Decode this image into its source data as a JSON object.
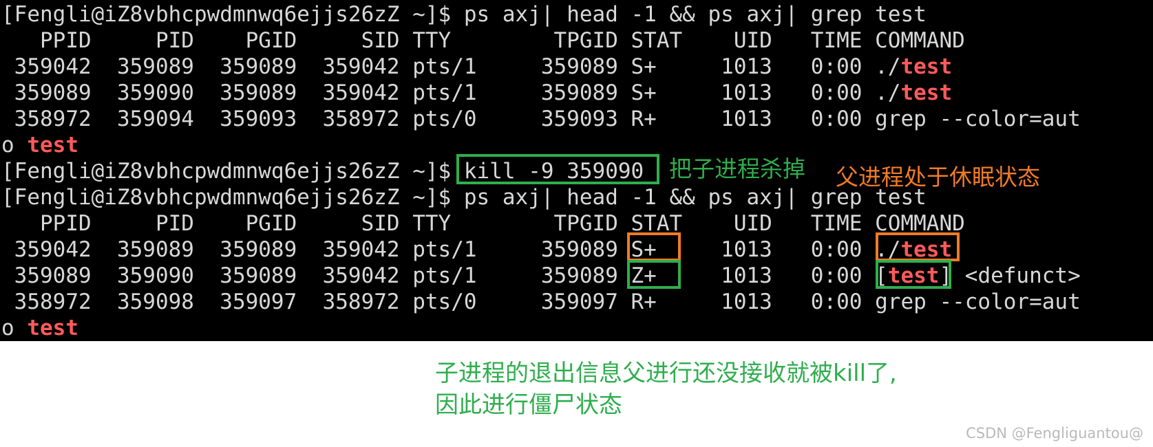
{
  "terminal": {
    "background_color": "#000000",
    "foreground_color": "#d8d8d8",
    "highlight_color": "#ff5a5a",
    "prompt": "[Fengli@iZ8vbhcpwdmnwq6ejjs26zZ ~]$ ",
    "lines": [
      {
        "id": "line-1-command",
        "kind": "prompt-command",
        "prompt": "[Fengli@iZ8vbhcpwdmnwq6ejjs26zZ ~]$ ",
        "command": "ps axj| head -1 && ps axj| grep test"
      },
      {
        "id": "line-2-header",
        "kind": "header",
        "text": "   PPID     PID    PGID     SID TTY        TPGID STAT    UID   TIME COMMAND"
      },
      {
        "id": "line-3-row",
        "kind": "row",
        "pre": " 359042  359089  359089  359042 pts/1     359089 S+     1013   0:00 ./",
        "match": "test",
        "post": ""
      },
      {
        "id": "line-4-row",
        "kind": "row",
        "pre": " 359089  359090  359089  359042 pts/1     359089 S+     1013   0:00 ./",
        "match": "test",
        "post": ""
      },
      {
        "id": "line-5-row",
        "kind": "row",
        "pre": " 358972  359094  359093  358972 pts/0     359093 R+     1013   0:00 grep --color=aut",
        "match": "",
        "post": ""
      },
      {
        "id": "line-6-wrap",
        "kind": "row",
        "pre": "o ",
        "match": "test",
        "post": ""
      },
      {
        "id": "line-7-command",
        "kind": "prompt-command",
        "prompt": "[Fengli@iZ8vbhcpwdmnwq6ejjs26zZ ~]$ ",
        "command": "kill -9 359090"
      },
      {
        "id": "line-8-command",
        "kind": "prompt-command",
        "prompt": "[Fengli@iZ8vbhcpwdmnwq6ejjs26zZ ~]$ ",
        "command": "ps axj| head -1 && ps axj| grep test"
      },
      {
        "id": "line-9-header",
        "kind": "header",
        "text": "   PPID     PID    PGID     SID TTY        TPGID STAT    UID   TIME COMMAND"
      },
      {
        "id": "line-10-row",
        "kind": "row",
        "pre": " 359042  359089  359089  359042 pts/1     359089 S+     1013   0:00 ./",
        "match": "test",
        "post": ""
      },
      {
        "id": "line-11-row",
        "kind": "row",
        "pre": " 359089  359090  359089  359042 pts/1     359089 Z+     1013   0:00 [",
        "match": "test",
        "post": "] <defunct>"
      },
      {
        "id": "line-12-row",
        "kind": "row",
        "pre": " 358972  359098  359097  358972 pts/0     359097 R+     1013   0:00 grep --color=aut",
        "match": "",
        "post": ""
      },
      {
        "id": "line-13-wrap",
        "kind": "row",
        "pre": "o ",
        "match": "test",
        "post": ""
      }
    ]
  },
  "highlights": [
    {
      "id": "kill-command-box",
      "color": "#2fae4e",
      "label": "kill -9 359090"
    },
    {
      "id": "parent-stat-box",
      "color": "#f07b26",
      "label": "S+"
    },
    {
      "id": "parent-command-box",
      "color": "#f07b26",
      "label": "./test"
    },
    {
      "id": "zombie-stat-box",
      "color": "#2fae4e",
      "label": "Z+"
    },
    {
      "id": "zombie-command-box",
      "color": "#2fae4e",
      "label": "[test]"
    }
  ],
  "annotations": {
    "kill_child": "把子进程杀掉",
    "parent_sleeping": "父进程处于休眠状态",
    "bottom_note": "子进程的退出信息父进行还没接收就被kill了,\n因此进行僵尸状态"
  },
  "watermark": "CSDN @Fengliguantou@"
}
